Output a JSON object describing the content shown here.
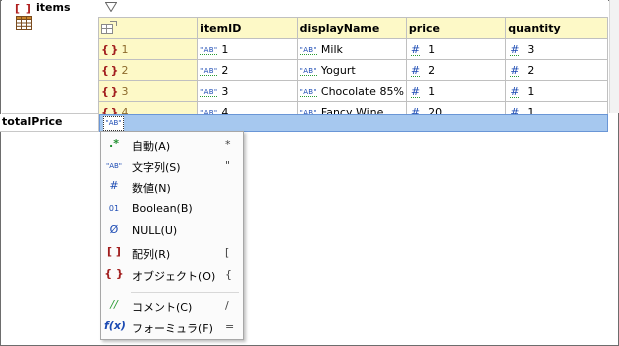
{
  "items_key": {
    "array_symbol": "[ ]",
    "name": "items"
  },
  "grid": {
    "headers": [
      "itemID",
      "displayName",
      "price",
      "quantity"
    ],
    "rows": [
      {
        "index": "1",
        "itemID": "1",
        "displayName": "Milk",
        "price": "1",
        "quantity": "3"
      },
      {
        "index": "2",
        "itemID": "2",
        "displayName": "Yogurt",
        "price": "2",
        "quantity": "2"
      },
      {
        "index": "3",
        "itemID": "3",
        "displayName": "Chocolate 85%",
        "price": "1",
        "quantity": "1"
      },
      {
        "index": "4",
        "itemID": "4",
        "displayName": "Fancy Wine",
        "price": "20",
        "quantity": "1"
      }
    ],
    "object_symbol": "{ }",
    "string_tag": "\"AB\"",
    "number_tag": "#"
  },
  "total": {
    "name": "totalPrice",
    "cell_tag": "\"AB\""
  },
  "menu": {
    "items": [
      {
        "icon": ".*",
        "label": "自動(A)",
        "shortcut": "*"
      },
      {
        "icon": "\"AB\"",
        "label": "文字列(S)",
        "shortcut": "\""
      },
      {
        "icon": "#",
        "label": "数値(N)",
        "shortcut": ""
      },
      {
        "icon": "01",
        "label": "Boolean(B)",
        "shortcut": ""
      },
      {
        "icon": "Ø",
        "label": "NULL(U)",
        "shortcut": ""
      },
      {
        "icon": "[ ]",
        "label": "配列(R)",
        "shortcut": "["
      },
      {
        "icon": "{ }",
        "label": "オブジェクト(O)",
        "shortcut": "{"
      },
      {
        "icon": "//",
        "label": "コメント(C)",
        "shortcut": "/"
      },
      {
        "icon": "f(x)",
        "label": "フォーミュラ(F)",
        "shortcut": "="
      }
    ]
  }
}
